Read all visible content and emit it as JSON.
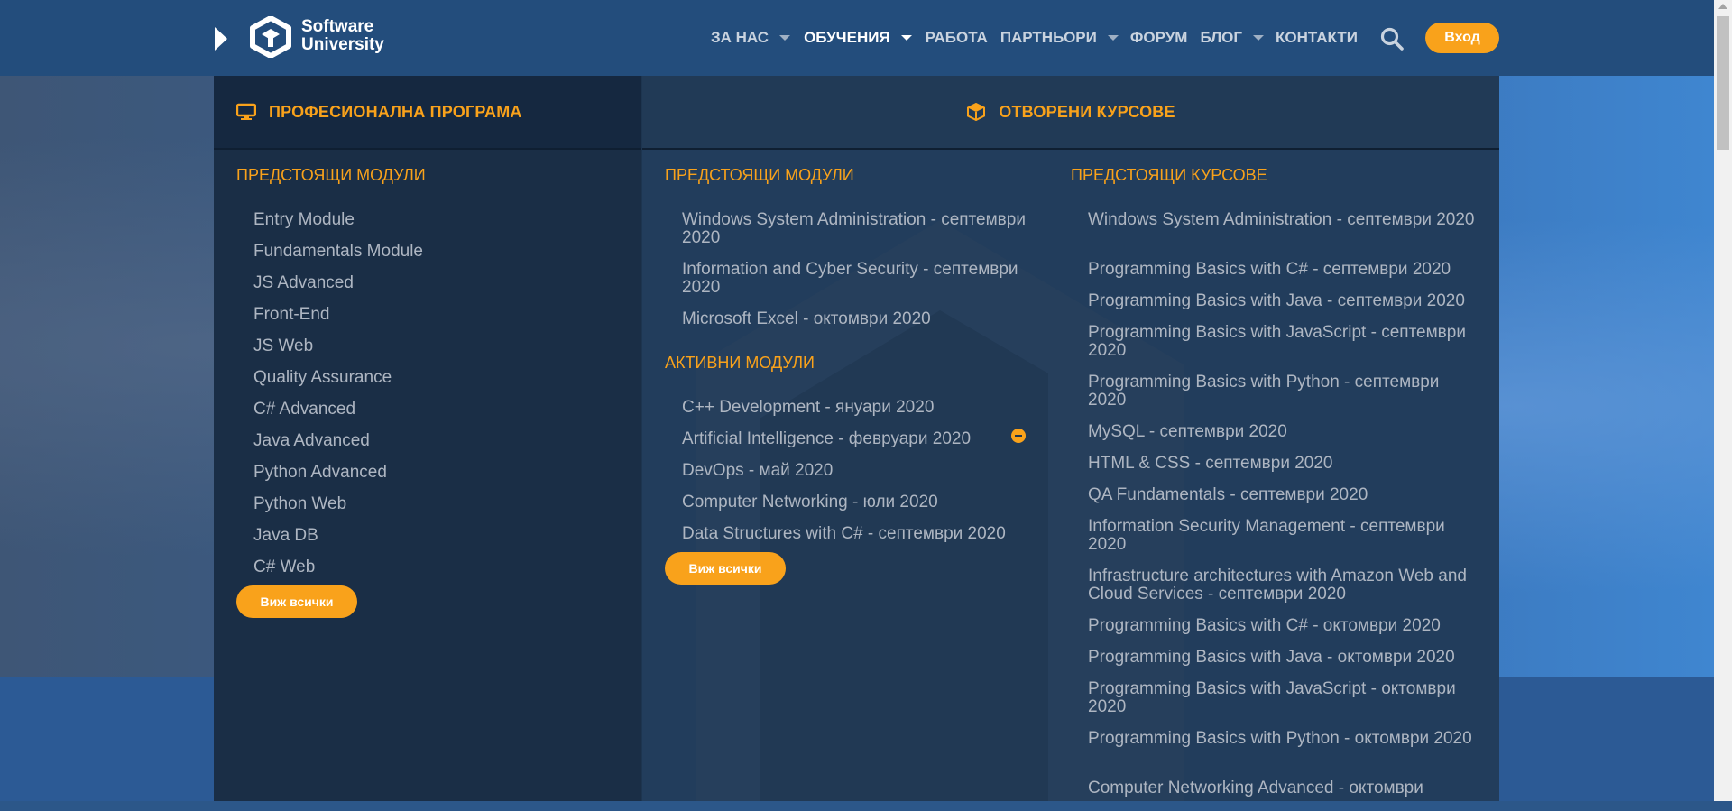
{
  "header": {
    "logo_line1": "Software",
    "logo_line2": "University",
    "nav": [
      {
        "label": "ЗА НАС"
      },
      {
        "label": "ОБУЧЕНИЯ"
      },
      {
        "label": "РАБОТА"
      },
      {
        "label": "ПАРТНЬОРИ"
      },
      {
        "label": "ФОРУМ"
      },
      {
        "label": "БЛОГ"
      },
      {
        "label": "КОНТАКТИ"
      }
    ],
    "login_label": "Вход"
  },
  "menu": {
    "left_header": "ПРОФЕСИОНАЛНА ПРОГРАМА",
    "right_header": "ОТВОРЕНИ КУРСОВЕ",
    "left": {
      "section_title": "ПРЕДСТОЯЩИ МОДУЛИ",
      "items": [
        "Entry Module",
        "Fundamentals Module",
        "JS Advanced",
        "Front-End",
        "JS Web",
        "Quality Assurance",
        "C# Advanced",
        "Java Advanced",
        "Python Advanced",
        "Python Web",
        "Java DB",
        "C# Web"
      ],
      "see_all": "Виж всички"
    },
    "middle": {
      "upcoming_title": "ПРЕДСТОЯЩИ МОДУЛИ",
      "upcoming_items": [
        "Windows System Administration - септември 2020",
        "Information and Cyber Security - септември 2020",
        "Microsoft Excel - октомври 2020"
      ],
      "active_title": "АКТИВНИ МОДУЛИ",
      "active_items": [
        "C++ Development - януари 2020",
        "Artificial Intelligence - февруари 2020",
        "DevOps - май 2020",
        "Computer Networking - юли 2020",
        "Data Structures with C# - септември 2020"
      ],
      "see_all": "Виж всички"
    },
    "right": {
      "section_title": "ПРЕДСТОЯЩИ КУРСОВЕ",
      "items": [
        "Windows System Administration - септември 2020",
        "Programming Basics with C# - септември 2020",
        "Programming Basics with Java - септември 2020",
        "Programming Basics with JavaScript - септември 2020",
        "Programming Basics with Python - септември 2020",
        "MySQL - септември 2020",
        "HTML & CSS - септември 2020",
        "QA Fundamentals - септември 2020",
        "Information Security Management - септември 2020",
        "Infrastructure architectures with Amazon Web and Cloud Services - септември 2020",
        "Programming Basics with C# - октомври 2020",
        "Programming Basics with Java - октомври 2020",
        "Programming Basics with JavaScript - октомври 2020",
        "Programming Basics with Python - октомври 2020",
        "Computer Networking Advanced - октомври"
      ]
    }
  },
  "colors": {
    "accent": "#f9a21b",
    "header_bg": "#234d7c",
    "menu_left_bg": "#1a2e46",
    "menu_right_bg": "#223d5c",
    "link_text": "#aeb6c2"
  },
  "icons": [
    "play-icon",
    "logo-icon",
    "search-icon",
    "monitor-icon",
    "cube-icon",
    "minus-circle-icon"
  ]
}
